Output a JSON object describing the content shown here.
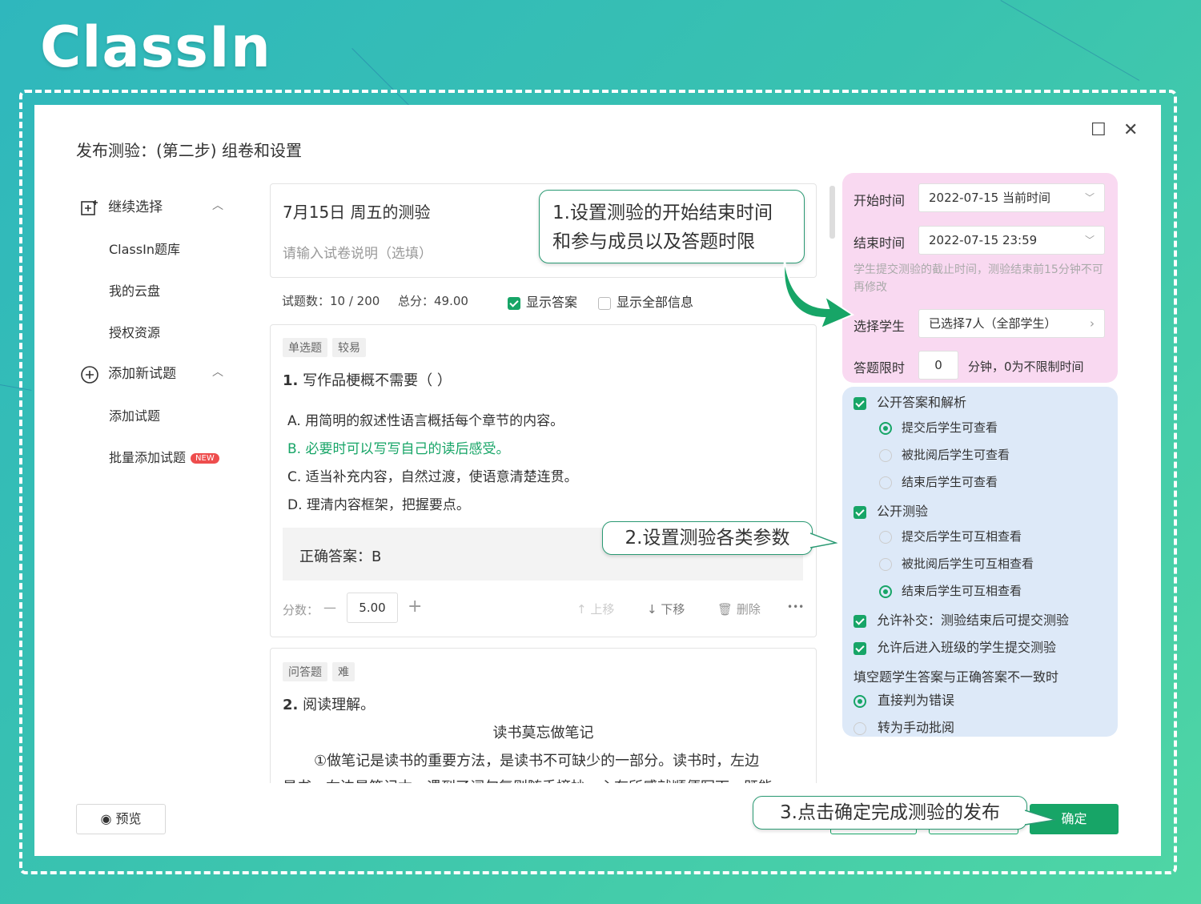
{
  "brand": {
    "logo_text": "ClassIn"
  },
  "dialog": {
    "title": "发布测验：(第二步) 组卷和设置"
  },
  "sidebar": {
    "sections": [
      {
        "label": "继续选择",
        "items": [
          "ClassIn题库",
          "我的云盘",
          "授权资源"
        ]
      },
      {
        "label": "添加新试题",
        "items": [
          "添加试题",
          "批量添加试题"
        ]
      }
    ],
    "new_badge": "NEW"
  },
  "paper": {
    "name": "7月15日 周五的测验",
    "desc_placeholder": "请输入试卷说明（选填）",
    "question_count": "试题数：10 / 200",
    "total_score": "总分：49.00",
    "show_answer": "显示答案",
    "show_all": "显示全部信息"
  },
  "q1": {
    "tags": [
      "单选题",
      "较易"
    ],
    "number": "1.",
    "stem": "写作品梗概不需要（      ）",
    "options": [
      "A. 用简明的叙述性语言概括每个章节的内容。",
      "B. 必要时可以写写自己的读后感受。",
      "C. 适当补充内容，自然过渡，使语意清楚连贯。",
      "D. 理清内容框架，把握要点。"
    ],
    "answer": "正确答案：B",
    "score_label": "分数：",
    "score_value": "5.00",
    "minus": "—",
    "plus": "+",
    "move_up": "上移",
    "move_down": "下移",
    "delete": "删除",
    "more": "•••"
  },
  "q2": {
    "tags": [
      "问答题",
      "难"
    ],
    "number": "2.",
    "stem": "阅读理解。",
    "passage_title": "读书莫忘做笔记",
    "passage_line": "①做笔记是读书的重要方法，是读书不可缺少的一部分。读书时，左边",
    "passage_cut": "是书，右边是笔记本，遇到了词句复则随手摘抄，心有所感就顺便写下，既能"
  },
  "settings": {
    "start_label": "开始时间",
    "start_value": "2022-07-15 当前时间",
    "end_label": "结束时间",
    "end_value": "2022-07-15 23:59",
    "end_hint": "学生提交测验的截止时间，测验结束前15分钟不可再修改",
    "students_label": "选择学生",
    "students_value": "已选择7人（全部学生）",
    "limit_label": "答题限时",
    "limit_value": "0",
    "limit_hint": "分钟，0为不限制时间",
    "public_answer": "公开答案和解析",
    "public_answer_opts": [
      "提交后学生可查看",
      "被批阅后学生可查看",
      "结束后学生可查看"
    ],
    "public_quiz": "公开测验",
    "public_quiz_opts": [
      "提交后学生可互相查看",
      "被批阅后学生可互相查看",
      "结束后学生可互相查看"
    ],
    "allow_late": "允许补交：测验结束后可提交测验",
    "allow_join": "允许后进入班级的学生提交测验",
    "fill_title": "填空题学生答案与正确答案不一致时",
    "fill_opts": [
      "直接判为错误",
      "转为手动批阅"
    ]
  },
  "callouts": {
    "c1_line1": "1.设置测验的开始结束时间",
    "c1_line2": "和参与成员以及答题时限",
    "c2": "2.设置测验各类参数",
    "c3": "3.点击确定完成测验的发布"
  },
  "footer": {
    "preview": "预览",
    "confirm": "确定"
  },
  "colors": {
    "accent": "#17a567",
    "pink": "#f9d9f1",
    "blue": "#dde9f8"
  }
}
